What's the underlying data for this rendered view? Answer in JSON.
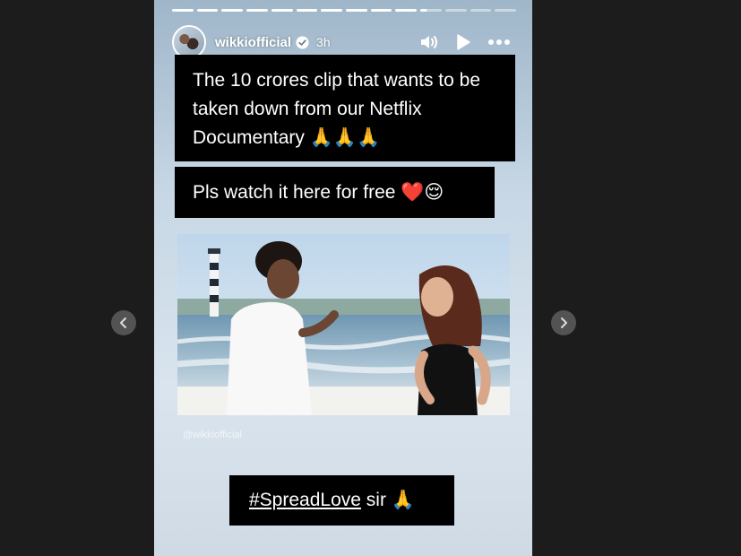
{
  "story": {
    "progress": [
      1,
      1,
      1,
      1,
      1,
      1,
      1,
      1,
      1,
      1,
      0.3,
      0,
      0,
      0
    ],
    "username": "wikkiofficial",
    "time": "3h",
    "captions": {
      "line1": "The 10 crores clip that wants to be taken down from our Netflix Documentary 🙏🙏🙏",
      "line2": "Pls watch it here for free ❤️😌",
      "hashtag": "#SpreadLove",
      "line3_suffix": " sir 🙏"
    },
    "watermark": "@wikkiofficial"
  },
  "icons": {
    "volume": "volume-icon",
    "play": "play-icon",
    "more": "more-options-icon",
    "verified": "verified-badge-icon",
    "prev": "chevron-left-icon",
    "next": "chevron-right-icon"
  }
}
